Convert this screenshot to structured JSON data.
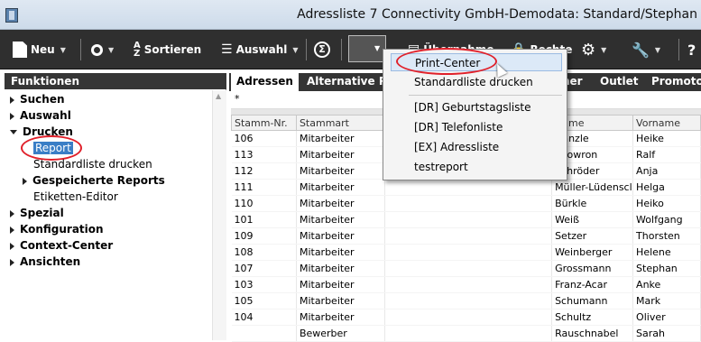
{
  "window": {
    "title": "Adressliste 7   Connectivity GmbH-Demodata: Standard/Stephan"
  },
  "toolbar": {
    "neu": "Neu",
    "sortieren": "Sortieren",
    "auswahl": "Auswahl",
    "rechte": "Rechte",
    "help": "?",
    "hidden_label": "Übernahme"
  },
  "sidebar": {
    "header": "Funktionen",
    "items": [
      {
        "label": "Suchen"
      },
      {
        "label": "Auswahl"
      },
      {
        "label": "Drucken"
      },
      {
        "label": "Report"
      },
      {
        "label": "Standardliste drucken"
      },
      {
        "label": "Gespeicherte Reports"
      },
      {
        "label": "Etiketten-Editor"
      },
      {
        "label": "Spezial"
      },
      {
        "label": "Konfiguration"
      },
      {
        "label": "Context-Center"
      },
      {
        "label": "Ansichten"
      }
    ]
  },
  "tabs": [
    "Adressen",
    "Alternative P",
    "ner",
    "Outlet",
    "Promoto"
  ],
  "filter": {
    "value": "*"
  },
  "table": {
    "columns": [
      "Stamm-Nr.",
      "Stammart",
      "",
      "Name",
      "Vorname"
    ],
    "rows": [
      [
        "106",
        "Mitarbeiter",
        "",
        "Hänzle",
        "Heike"
      ],
      [
        "113",
        "Mitarbeiter",
        "",
        "Litowron",
        "Ralf"
      ],
      [
        "112",
        "Mitarbeiter",
        "",
        "Schröder",
        "Anja"
      ],
      [
        "111",
        "Mitarbeiter",
        "",
        "Müller-Lüdenscl",
        "Helga"
      ],
      [
        "110",
        "Mitarbeiter",
        "",
        "Bürkle",
        "Heiko"
      ],
      [
        "101",
        "Mitarbeiter",
        "",
        "Weiß",
        "Wolfgang"
      ],
      [
        "109",
        "Mitarbeiter",
        "",
        "Setzer",
        "Thorsten"
      ],
      [
        "108",
        "Mitarbeiter",
        "",
        "Weinberger",
        "Helene"
      ],
      [
        "107",
        "Mitarbeiter",
        "",
        "Grossmann",
        "Stephan"
      ],
      [
        "103",
        "Mitarbeiter",
        "",
        "Franz-Acar",
        "Anke"
      ],
      [
        "105",
        "Mitarbeiter",
        "",
        "Schumann",
        "Mark"
      ],
      [
        "104",
        "Mitarbeiter",
        "",
        "Schultz",
        "Oliver"
      ],
      [
        "",
        "Bewerber",
        "",
        "Rauschnabel",
        "Sarah"
      ]
    ]
  },
  "menu": {
    "items": [
      {
        "label": "Print-Center"
      },
      {
        "label": "Standardliste drucken"
      },
      {
        "label": "[DR] Geburtstagsliste"
      },
      {
        "label": "[DR] Telefonliste"
      },
      {
        "label": "[EX] Adressliste"
      },
      {
        "label": "testreport"
      }
    ]
  },
  "colors": {
    "toolbar": "#2f2f2f",
    "selection": "#3a7ec6",
    "highlight_ellipse": "#e0202a"
  },
  "icons": [
    "app-icon",
    "new-doc-icon",
    "search-icon",
    "sort-az-icon",
    "selection-list-icon",
    "sigma-icon",
    "print-icon",
    "transfer-icon",
    "lock-icon",
    "gear-icon",
    "wrench-icon"
  ]
}
